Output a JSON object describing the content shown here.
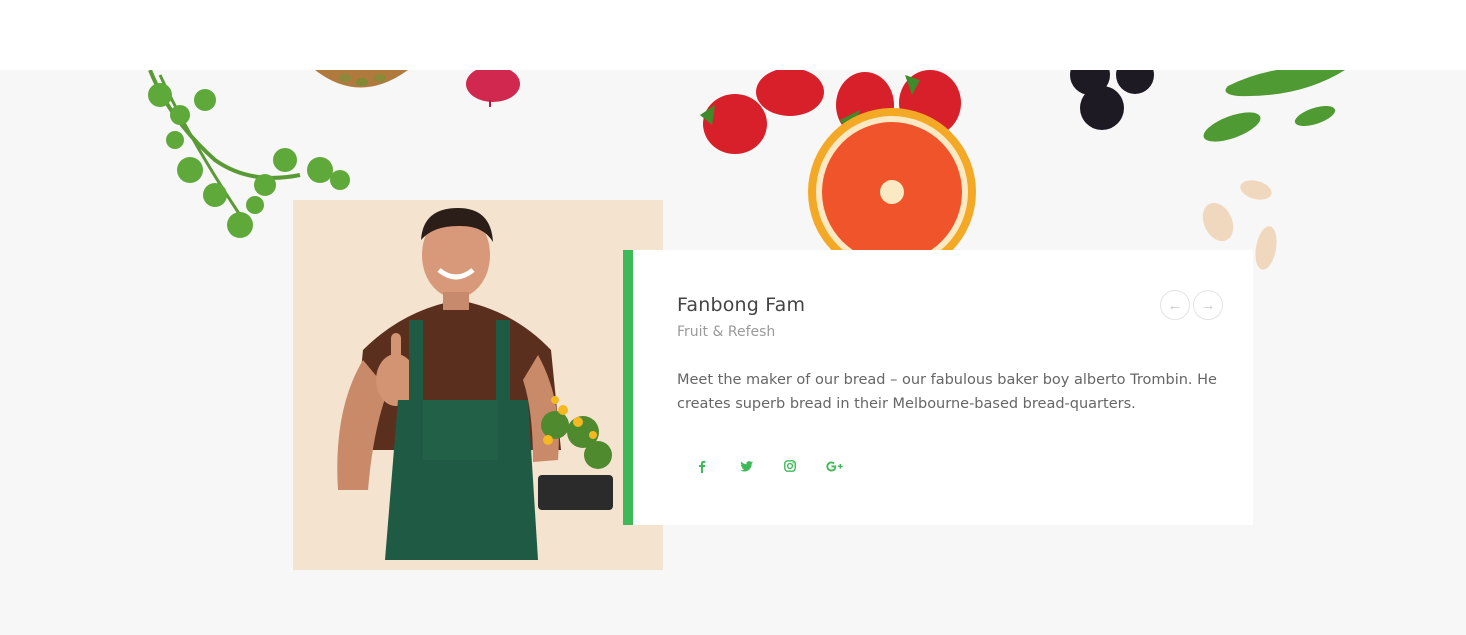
{
  "member": {
    "name": "Fanbong Fam",
    "role": "Fruit & Refesh",
    "bio": "Meet the maker of our bread – our fabulous baker boy alberto Trombin. He creates superb bread in their Melbourne-based bread-quarters."
  },
  "navigation": {
    "prev_icon": "arrow-left-icon",
    "next_icon": "arrow-right-icon",
    "prev_glyph": "←",
    "next_glyph": "→"
  },
  "socials": [
    {
      "icon": "facebook-icon"
    },
    {
      "icon": "twitter-icon"
    },
    {
      "icon": "instagram-icon"
    },
    {
      "icon": "google-plus-icon"
    }
  ],
  "colors": {
    "accent": "#3dba57",
    "section_bg": "#f7f7f7",
    "photo_bg": "#f3e3cf"
  }
}
